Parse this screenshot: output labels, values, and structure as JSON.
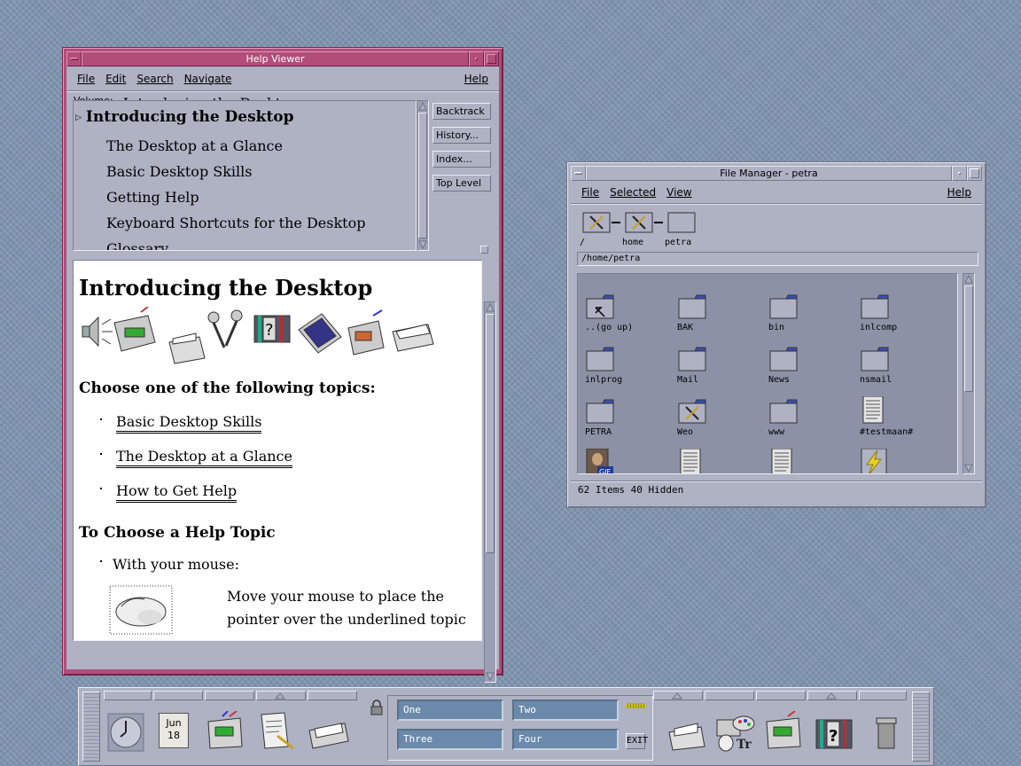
{
  "help_viewer": {
    "title": "Help Viewer",
    "menus": [
      "File",
      "Edit",
      "Search",
      "Navigate"
    ],
    "help_menu": "Help",
    "volume_label": "Volume:",
    "volume_value": "Introducing the Desktop",
    "topics": [
      "Introducing the Desktop",
      "The Desktop at a Glance",
      "Basic Desktop Skills",
      "Getting Help",
      "Keyboard Shortcuts for the Desktop",
      "Glossary"
    ],
    "buttons": [
      "Backtrack",
      "History...",
      "Index...",
      "Top Level"
    ],
    "content": {
      "heading": "Introducing the Desktop",
      "choose_heading": "Choose one of the following topics:",
      "links": [
        "Basic Desktop Skills",
        "The Desktop at a Glance",
        "How to Get Help"
      ],
      "subheading": "To Choose a Help Topic",
      "mouse_item": "With your mouse:",
      "mouse_text_1": "Move your mouse to place the",
      "mouse_text_2": "pointer over the underlined topic"
    }
  },
  "file_manager": {
    "title": "File Manager - petra",
    "menus": [
      "File",
      "Selected",
      "View"
    ],
    "help_menu": "Help",
    "path_labels": [
      "/",
      "home",
      "petra"
    ],
    "path_field": "/home/petra",
    "items": [
      {
        "label": "..(go up)",
        "icon": "go-up-folder"
      },
      {
        "label": "BAK",
        "icon": "folder"
      },
      {
        "label": "bin",
        "icon": "folder"
      },
      {
        "label": "inlcomp",
        "icon": "folder"
      },
      {
        "label": "inlprog",
        "icon": "folder"
      },
      {
        "label": "Mail",
        "icon": "folder"
      },
      {
        "label": "News",
        "icon": "folder"
      },
      {
        "label": "nsmail",
        "icon": "folder"
      },
      {
        "label": "PETRA",
        "icon": "folder"
      },
      {
        "label": "Weo",
        "icon": "locked-folder"
      },
      {
        "label": "www",
        "icon": "folder"
      },
      {
        "label": "#testmaan#",
        "icon": "document"
      },
      {
        "label": "",
        "icon": "gif-image"
      },
      {
        "label": "",
        "icon": "document"
      },
      {
        "label": "",
        "icon": "document"
      },
      {
        "label": "",
        "icon": "executable"
      }
    ],
    "status": "62 Items 40 Hidden"
  },
  "front_panel": {
    "date_month": "Jun",
    "date_day": "18",
    "workspaces": [
      "One",
      "Two",
      "Three",
      "Four"
    ],
    "exit_label": "EXIT"
  },
  "colors": {
    "active_frame": "#b24d7a",
    "inactive_frame": "#aeb2c3",
    "workspace_button": "#6b8aab",
    "desktop": "#7f93ad"
  }
}
